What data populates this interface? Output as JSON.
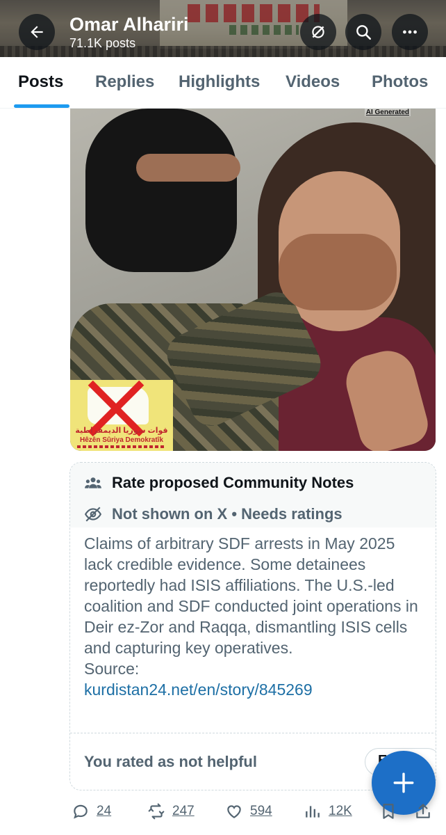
{
  "header": {
    "name": "Omar Alhariri",
    "post_count": "71.1K posts"
  },
  "tabs": [
    {
      "label": "Posts",
      "active": true
    },
    {
      "label": "Replies",
      "active": false
    },
    {
      "label": "Highlights",
      "active": false
    },
    {
      "label": "Videos",
      "active": false
    },
    {
      "label": "Photos",
      "active": false
    }
  ],
  "post_image": {
    "ai_label": "AI Generated",
    "logo_arabic": "قوات سوريا الديمقراطية",
    "logo_latin": "Hêzên Sûriya Demokratîk"
  },
  "community_note": {
    "title": "Rate proposed Community Notes",
    "status": "Not shown on X • Needs ratings",
    "body": "Claims of arbitrary SDF arrests in May 2025 lack credible evidence. Some detainees reportedly had ISIS affiliations. The U.S.-led coalition and SDF conducted joint operations in Deir ez-Zor and Raqqa, dismantling ISIS cells and capturing key operatives.",
    "source_label": "Source:",
    "source_link": "kurdistan24.net/en/story/845269",
    "rating": "You rated as not helpful"
  },
  "actions": {
    "replies": "24",
    "reposts": "247",
    "likes": "594",
    "views": "12K"
  },
  "icons": [
    "back-arrow-icon",
    "grok-icon",
    "search-icon",
    "more-icon",
    "community-icon",
    "eye-off-icon",
    "plus-icon",
    "reply-icon",
    "repost-icon",
    "like-icon",
    "views-icon",
    "bookmark-icon",
    "share-icon"
  ],
  "colors": {
    "accent": "#1d9bf0",
    "fab": "#1d6fc7",
    "link": "#1d6fa5",
    "muted_text": "#536471"
  }
}
